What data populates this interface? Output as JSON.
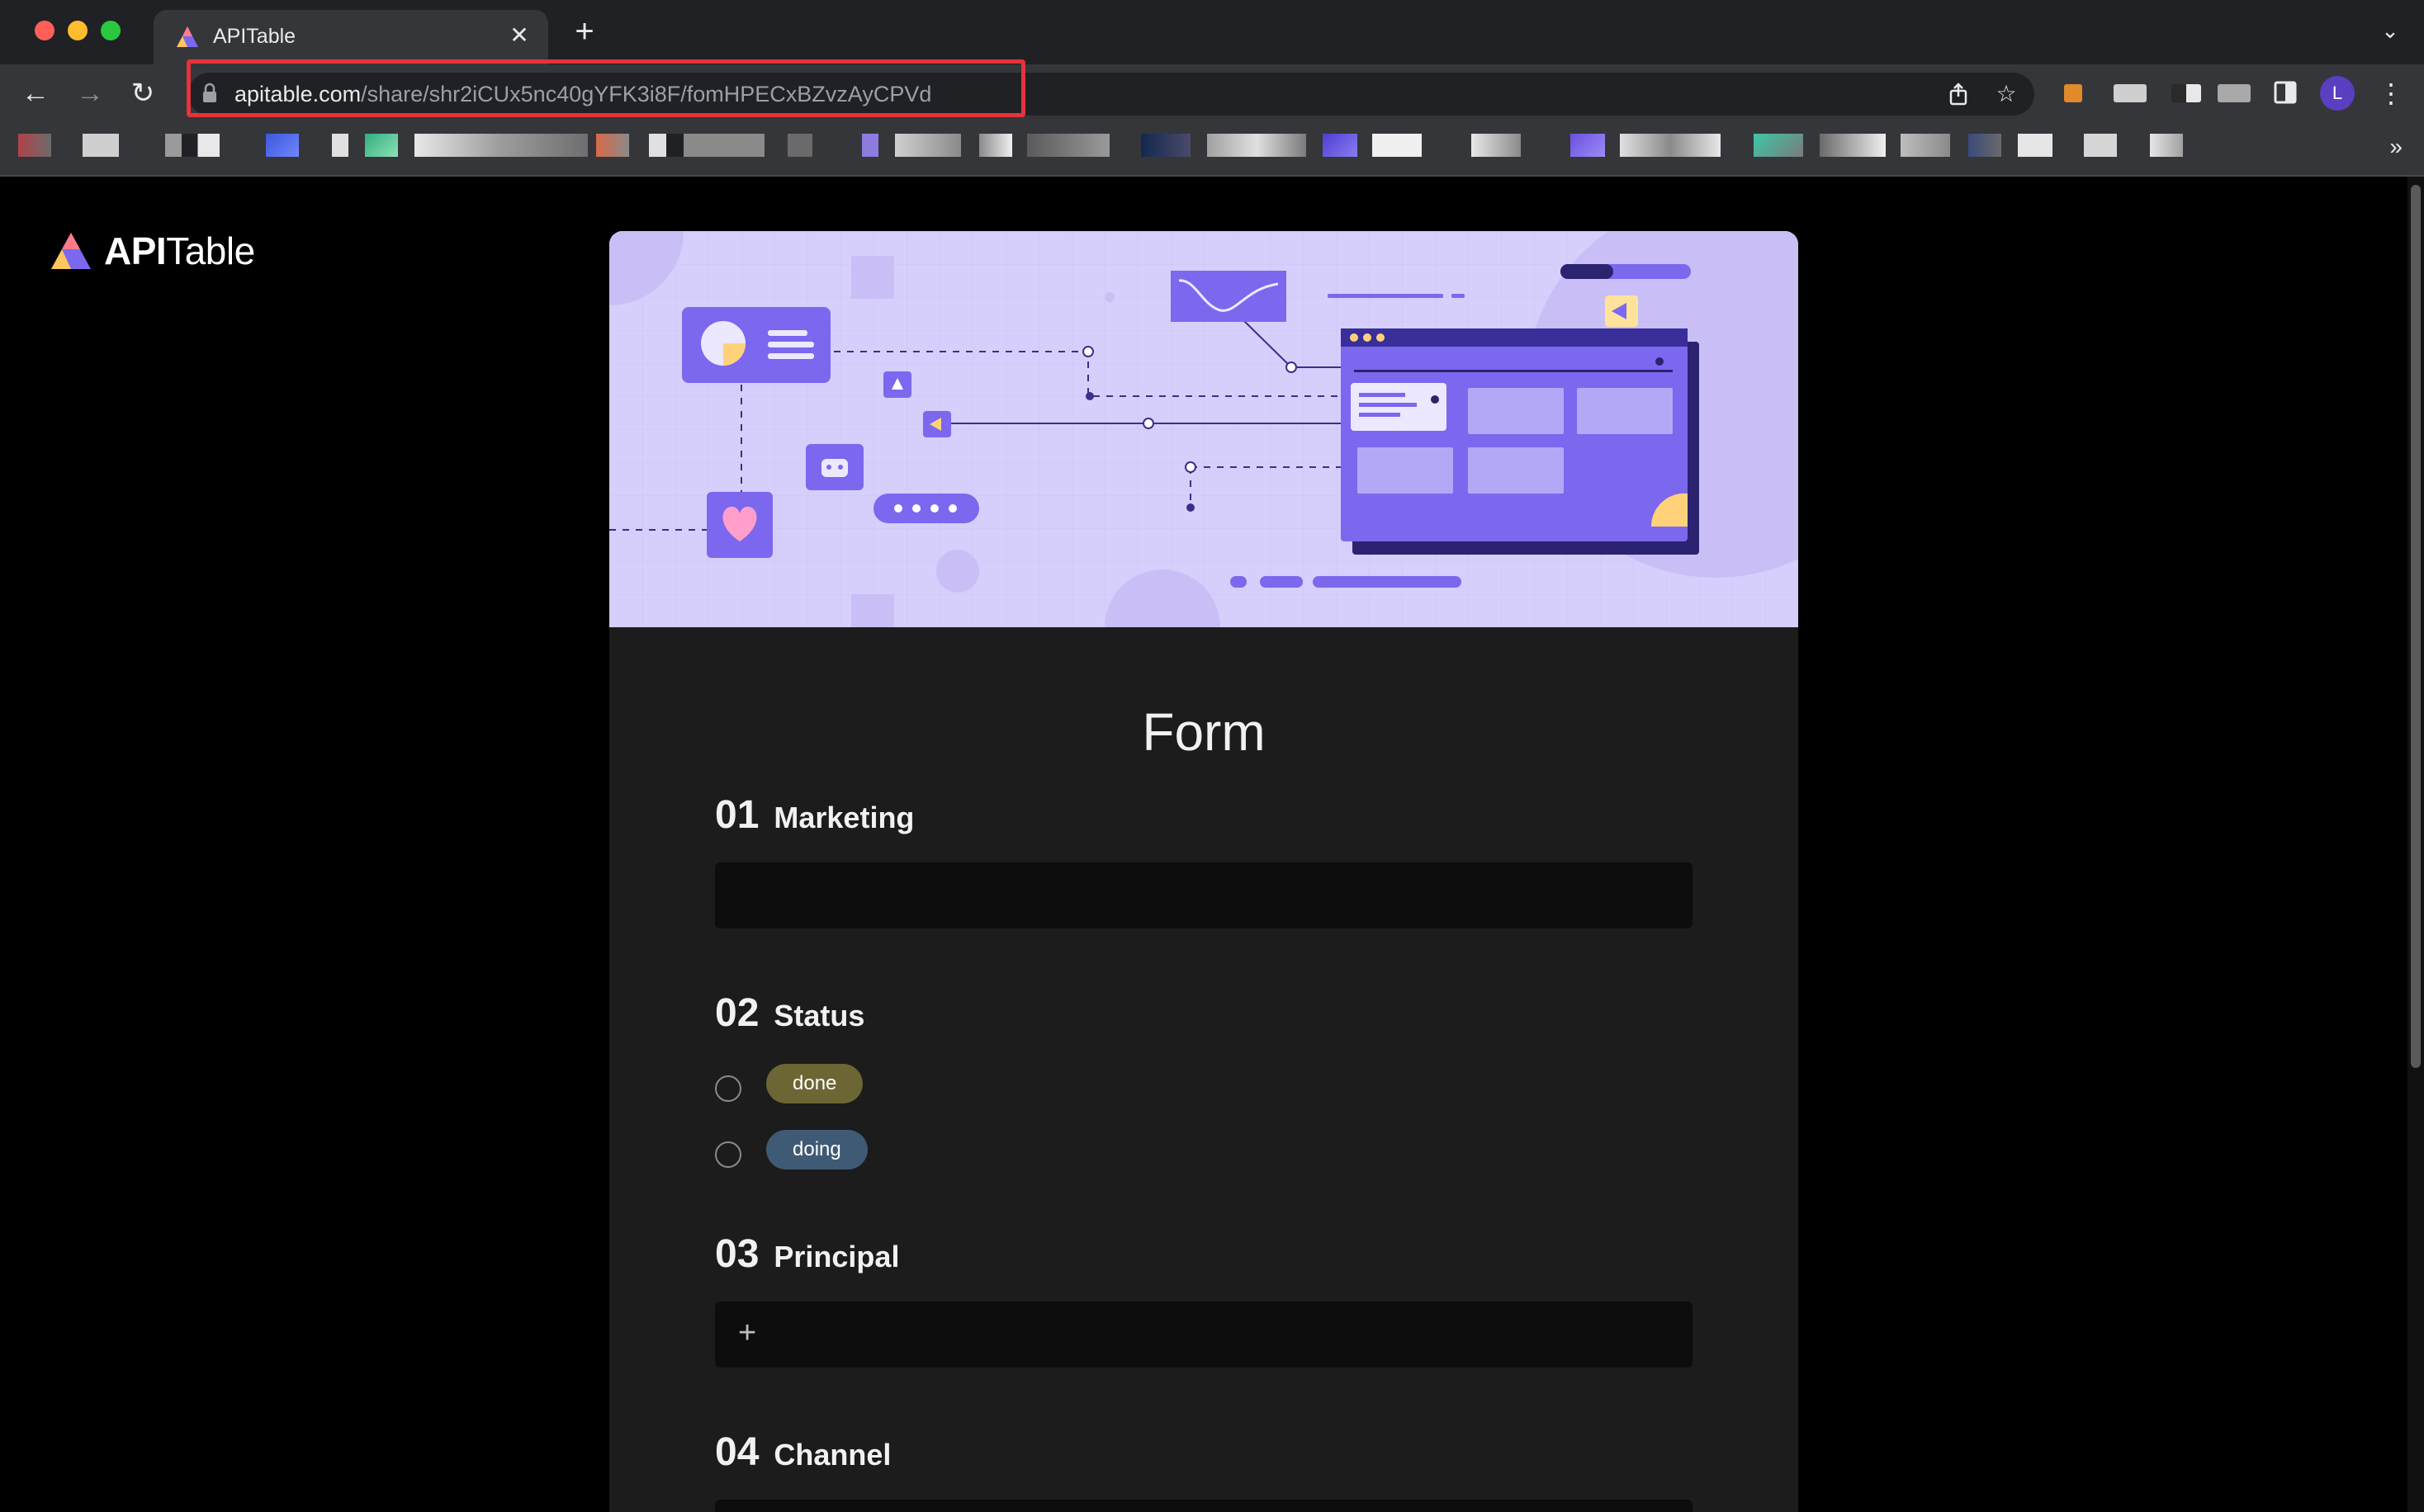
{
  "browser": {
    "tab_title": "APITable",
    "new_tab_label": "+",
    "close_label": "✕",
    "url_host": "apitable.com",
    "url_path": "/share/shr2iCUx5nc40gYFK3i8F/fomHPECxBZvzAyCPVd",
    "profile_initial": "L",
    "bookmarks_more": "»",
    "nav": {
      "back": "←",
      "forward": "→",
      "reload": "↻"
    },
    "icons": {
      "share": "share-icon",
      "star": "star-icon",
      "sidebar": "side-panel-icon",
      "menu": "kebab-menu-icon"
    }
  },
  "logo": {
    "bold": "API",
    "regular": "Table"
  },
  "form": {
    "title": "Form",
    "fields": [
      {
        "num": "01",
        "name": "Marketing"
      },
      {
        "num": "02",
        "name": "Status",
        "options": [
          "done",
          "doing"
        ]
      },
      {
        "num": "03",
        "name": "Principal",
        "add_label": "+"
      },
      {
        "num": "04",
        "name": "Channel"
      }
    ]
  },
  "colors": {
    "accent": "#7b68ee",
    "tag_done": "#6c6634",
    "tag_doing": "#3f5a74",
    "url_highlight": "#e5333a"
  }
}
